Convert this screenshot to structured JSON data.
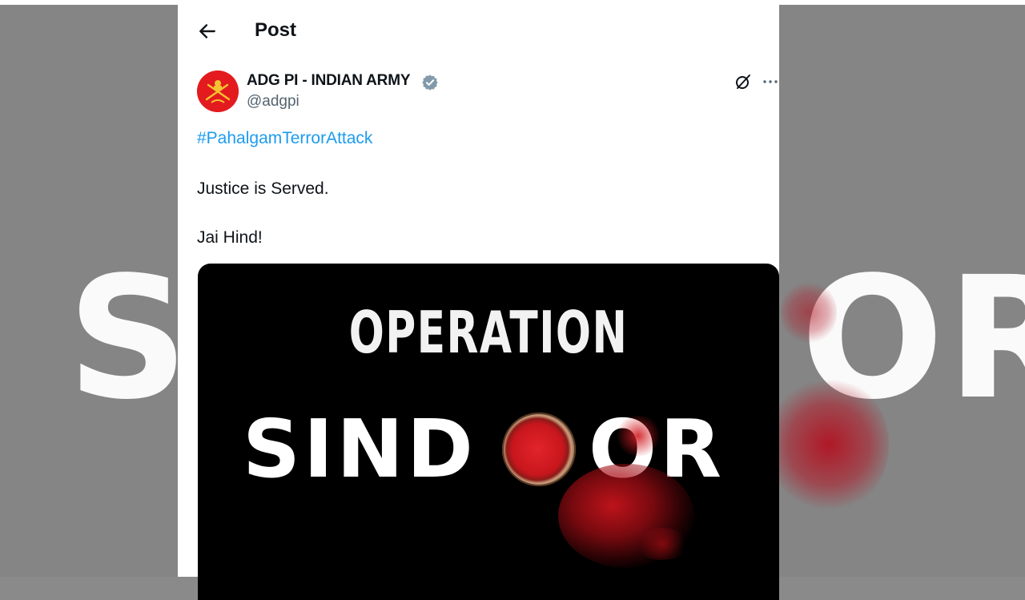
{
  "backdrop": {
    "word_left": "S",
    "word_right": "OR"
  },
  "header": {
    "back_icon": "arrow-left-icon",
    "title": "Post"
  },
  "post": {
    "author_name": "ADG PI - INDIAN ARMY",
    "author_handle": "@adgpi",
    "verified_icon": "verified-badge-icon",
    "hashtag": "#PahalgamTerrorAttack",
    "lines": [
      "Justice is Served.",
      "Jai Hind!"
    ],
    "actions": {
      "grok_icon": "grok-icon",
      "more_icon": "more-horizontal-icon"
    }
  },
  "media": {
    "line1": "OPERATION",
    "word_before": "SIND",
    "word_after": "OR"
  },
  "colors": {
    "link": "#1d9bf0",
    "text": "#0f1419",
    "muted": "#536471",
    "avatar_bg": "#e8181d",
    "sindoor_red": "#c8161d"
  }
}
